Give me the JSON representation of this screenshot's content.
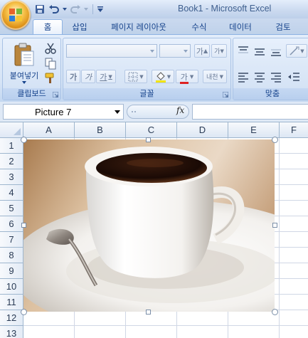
{
  "window": {
    "title": "Book1 - Microsoft Excel"
  },
  "ribbon": {
    "tabs": [
      {
        "label": "홈",
        "active": true
      },
      {
        "label": "삽입"
      },
      {
        "label": "페이지 레이아웃"
      },
      {
        "label": "수식"
      },
      {
        "label": "데이터"
      },
      {
        "label": "검토"
      }
    ],
    "clipboard": {
      "paste_label": "붙여넣기",
      "group_label": "클립보드"
    },
    "font": {
      "grow_label": "가",
      "shrink_label": "가",
      "bold_label": "가",
      "italic_label": "가",
      "underline_label": "가",
      "fill_label": "◇",
      "color_label": "가",
      "phonetic_label": "내천",
      "group_label": "글꼴"
    },
    "alignment": {
      "group_label": "맞춤"
    }
  },
  "formula_bar": {
    "name_box": "Picture 7",
    "fx_label": "fx",
    "formula": ""
  },
  "grid": {
    "columns": [
      "A",
      "B",
      "C",
      "D",
      "E",
      "F"
    ],
    "rows": [
      "1",
      "2",
      "3",
      "4",
      "5",
      "6",
      "7",
      "8",
      "9",
      "10",
      "11",
      "12",
      "13"
    ]
  },
  "picture": {
    "subject": "coffee cup on saucer with spoon",
    "selected": true
  },
  "colors": {
    "ribbon_text": "#15428b",
    "accent": "#8db2e3"
  }
}
